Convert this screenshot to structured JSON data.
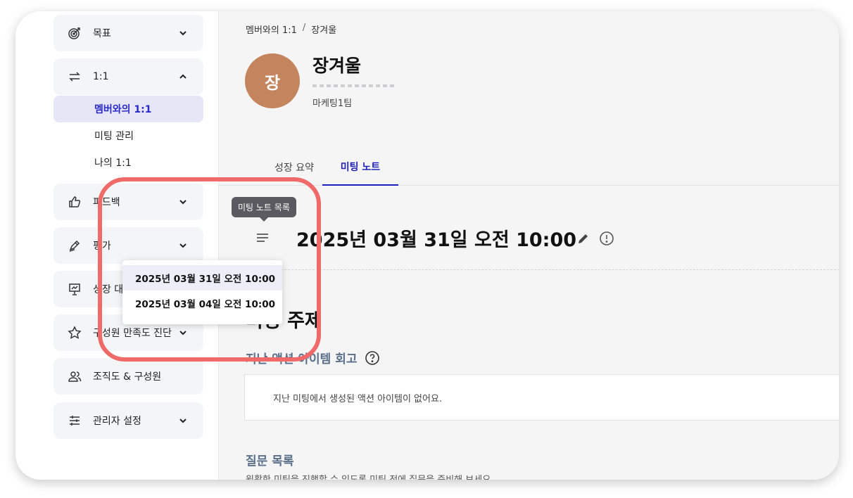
{
  "sidebar": {
    "items": [
      {
        "label": "목표",
        "icon": "target-icon",
        "expanded": false
      },
      {
        "label": "1:1",
        "icon": "swap-arrows-icon",
        "expanded": true
      },
      {
        "label": "피드백",
        "icon": "thumbs-up-icon",
        "expanded": false
      },
      {
        "label": "평가",
        "icon": "pen-icon",
        "expanded": false
      },
      {
        "label": "성장 대",
        "icon": "presentation-icon",
        "expanded": false
      },
      {
        "label": "구성원 만족도 진단",
        "icon": "star-icon",
        "expanded": false
      },
      {
        "label": "조직도 & 구성원",
        "icon": "people-icon",
        "expanded": false
      },
      {
        "label": "관리자 설정",
        "icon": "sliders-icon",
        "expanded": false
      }
    ],
    "sub_items": [
      "멤버와의 1:1",
      "미팅 관리",
      "나의 1:1"
    ]
  },
  "breadcrumb": {
    "parent": "멤버와의 1:1",
    "separator": "/",
    "current": "장겨울"
  },
  "profile": {
    "avatar_initial": "장",
    "name": "장겨울",
    "team": "마케팅1팀",
    "avatar_color": "#c4845e"
  },
  "tabs": [
    {
      "label": "성장 요약",
      "active": false
    },
    {
      "label": "미팅 노트",
      "active": true
    }
  ],
  "meeting": {
    "tooltip": "미팅 노트 목록",
    "title": "2025년 03월 31일 오전 10:00",
    "dropdown": [
      "2025년 03월 31일 오전 10:00",
      "2025년 03월 04일 오전 10:00"
    ]
  },
  "content": {
    "section_title": "미팅 주제",
    "action_review_title": "지난 액션 아이템 회고",
    "action_empty_text": "지난 미팅에서 생성된 액션 아이템이 없어요.",
    "questions_title": "질문 목록",
    "questions_desc": "원활한 미팅을 진행할 수 있도록 미팅 전에 질문을 준비해 보세요."
  },
  "colors": {
    "accent": "#1f1fbd",
    "highlight": "#f06a6a",
    "subheading": "#5a6f8a"
  }
}
